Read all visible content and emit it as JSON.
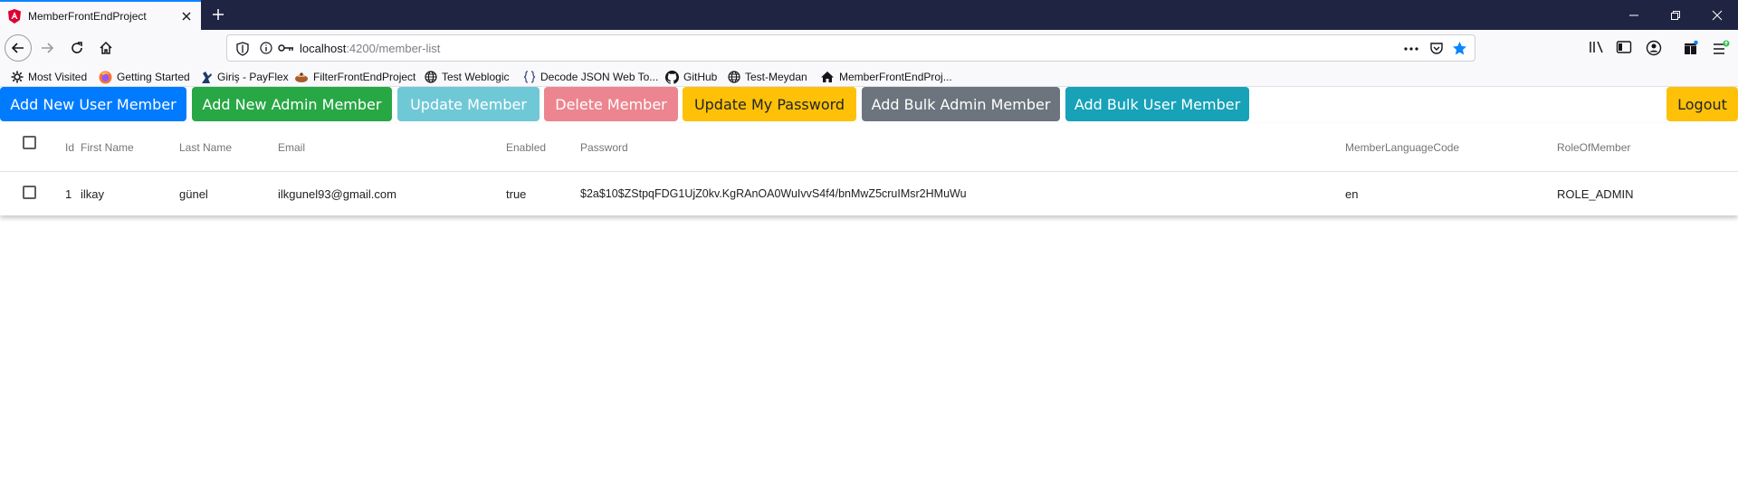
{
  "browser": {
    "tab_title": "MemberFrontEndProject",
    "url_host": "localhost",
    "url_path": ":4200/member-list"
  },
  "bookmarks": [
    {
      "label": "Most Visited",
      "icon": "gear-icon"
    },
    {
      "label": "Getting Started",
      "icon": "firefox-icon"
    },
    {
      "label": "Giriş - PayFlex",
      "icon": "payflex-icon"
    },
    {
      "label": "FilterFrontEndProject",
      "icon": "filter-project-icon"
    },
    {
      "label": "Test Weblogic",
      "icon": "globe-icon"
    },
    {
      "label": "Decode JSON Web To...",
      "icon": "json-braces-icon"
    },
    {
      "label": "GitHub",
      "icon": "github-icon"
    },
    {
      "label": "Test-Meydan",
      "icon": "globe-icon"
    },
    {
      "label": "MemberFrontEndProj...",
      "icon": "home-icon"
    }
  ],
  "actions": {
    "add_user": "Add New User Member",
    "add_admin": "Add New Admin Member",
    "update": "Update Member",
    "delete": "Delete Member",
    "update_password": "Update My Password",
    "bulk_admin": "Add Bulk Admin Member",
    "bulk_user": "Add Bulk User Member",
    "logout": "Logout"
  },
  "table": {
    "columns": [
      "Id",
      "First Name",
      "Last Name",
      "Email",
      "Enabled",
      "Password",
      "MemberLanguageCode",
      "RoleOfMember"
    ],
    "rows": [
      [
        "1",
        "ilkay",
        "günel",
        "ilkgunel93@gmail.com",
        "true",
        "$2a$10$ZStpqFDG1UjZ0kv.KgRAnOA0WuIvvS4f4/bnMwZ5cruIMsr2HMuWu",
        "en",
        "ROLE_ADMIN"
      ]
    ]
  },
  "colors": {
    "primary": "#007bff",
    "success": "#28a745",
    "info_light": "#6fc8d6",
    "danger_light": "#ec858f",
    "warning": "#ffc107",
    "secondary": "#6c757d",
    "info": "#17a2b8",
    "browser_chrome": "#1f2442"
  }
}
